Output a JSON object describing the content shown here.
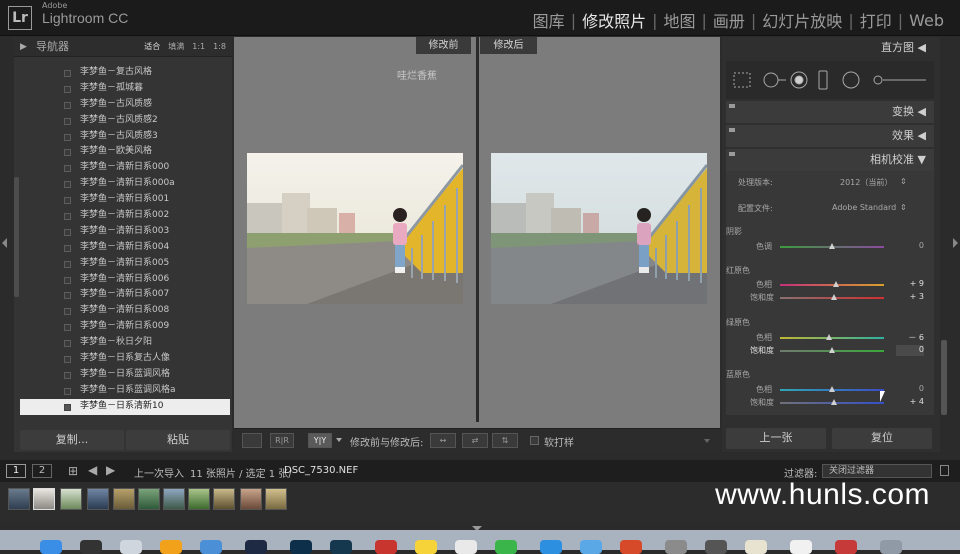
{
  "app": {
    "vendor_small": "Adobe",
    "name": "Lightroom CC",
    "logo": "Lr"
  },
  "modules": [
    "图库",
    "修改照片",
    "地图",
    "画册",
    "幻灯片放映",
    "打印",
    "Web"
  ],
  "active_module": "修改照片",
  "navigator": {
    "title": "导航器",
    "zoom_options": [
      "适合",
      "填满",
      "1:1",
      "1:8"
    ]
  },
  "presets": [
    "李梦鱼－复古风格",
    "李梦鱼－孤城暮",
    "李梦鱼－古风质感",
    "李梦鱼－古风质感2",
    "李梦鱼－古风质感3",
    "李梦鱼－欧美风格",
    "李梦鱼－清新日系000",
    "李梦鱼－清新日系000a",
    "李梦鱼－清新日系001",
    "李梦鱼－清新日系002",
    "李梦鱼－清新日系003",
    "李梦鱼－清新日系004",
    "李梦鱼－清新日系005",
    "李梦鱼－清新日系006",
    "李梦鱼－清新日系007",
    "李梦鱼－清新日系008",
    "李梦鱼－清新日系009",
    "李梦鱼－秋日夕阳",
    "李梦鱼－日系复古人像",
    "李梦鱼－日系蓝调风格",
    "李梦鱼－日系蓝调风格a",
    "李梦鱼－日系清新10"
  ],
  "selected_preset_index": 21,
  "left_buttons": {
    "copy": "复制...",
    "paste": "粘贴"
  },
  "view": {
    "before_label": "修改前",
    "after_label": "修改后",
    "photo_caption": "哇烂香蕉"
  },
  "toolbar": {
    "mode_icons": [
      "loupe-icon",
      "before-after-lr-icon",
      "before-after-yy-icon"
    ],
    "before_after_label": "修改前与修改后:",
    "soft_proof_label": "软打样",
    "mode_yy": "Y|Y",
    "mode_rr": "R|R"
  },
  "right_panel": {
    "histogram": "直方图",
    "transform": "变换",
    "effects": "效果",
    "calibration": "相机校准",
    "process_label": "处理版本:",
    "process_value": "2012（当前）",
    "profile_label": "配置文件:",
    "profile_value": "Adobe Standard",
    "shadows": {
      "title": "阴影",
      "tint_label": "色调",
      "tint_value": "0"
    },
    "red_primary": {
      "title": "红原色",
      "hue_label": "色相",
      "hue_value": "+ 9",
      "sat_label": "饱和度",
      "sat_value": "+ 3"
    },
    "green_primary": {
      "title": "绿原色",
      "hue_label": "色相",
      "hue_value": "－ 6",
      "sat_label": "饱和度",
      "sat_value": "0"
    },
    "blue_primary": {
      "title": "蓝原色",
      "hue_label": "色相",
      "hue_value": "0",
      "sat_label": "饱和度",
      "sat_value": "+ 4"
    },
    "slider_levels": {
      "shadow_tint": 0.5,
      "red_hue": 0.54,
      "red_sat": 0.52,
      "green_hue": 0.47,
      "green_sat": 0.5,
      "blue_hue": 0.5,
      "blue_sat": 0.52
    },
    "prev_button": "上一张",
    "reset_button": "复位"
  },
  "filmstrip": {
    "page_1": "1",
    "page_2": "2",
    "source": "上一次导入",
    "info": "11 张照片 / 选定 1 张/",
    "filename": "DSC_7530.NEF",
    "filter_label": "过滤器:",
    "filter_value": "关闭过滤器"
  },
  "watermark": "www.hunls.com",
  "colors": {
    "accent_selected": "#ededed",
    "panel": "#343434",
    "background": "#7c7c7c"
  }
}
